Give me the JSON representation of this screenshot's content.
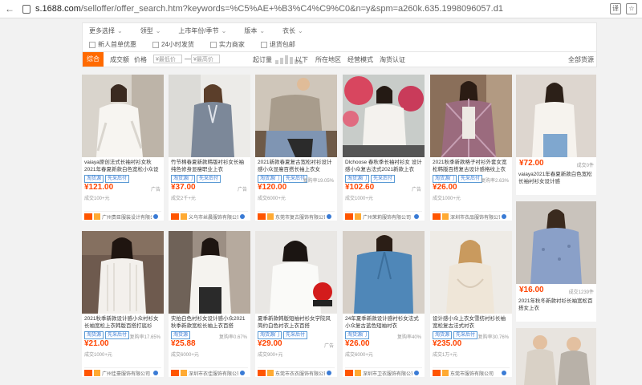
{
  "address_bar": {
    "url_host": "s.1688.com",
    "url_rest": "/selloffer/offer_search.htm?keywords=%C5%AE+%B3%C4%C9%C0&n=y&spm=a260k.635.1998096057.d1"
  },
  "filters": {
    "row1": [
      "更多选择",
      "领型",
      "上市年份/季节",
      "版本",
      "衣长"
    ],
    "row2": [
      "新人首单优惠",
      "24小时发货",
      "实力商家",
      "退货包邮"
    ]
  },
  "sort": {
    "comprehensive": "综合",
    "sales": "成交额",
    "price": "价格",
    "price_min_placeholder": "¥最低价",
    "dash": "—",
    "price_max_placeholder": "¥最高价",
    "start_qty_label": "起订量",
    "below": "以下",
    "location": "所在地区",
    "mode": "经营模式",
    "certify": "淘货认证",
    "all_shops": "全部货源"
  },
  "products": [
    {
      "title": "vaiaya原创法式长袖衬衫女秋2021年春夏新款白色宽松小众设计感衬衣",
      "tags": [
        "淘货源",
        "先采后付"
      ],
      "price": "¥121.00",
      "meta": "广告",
      "deal": "成交100+元",
      "shop": "广州贵臣服装设计有限公司"
    },
    {
      "title": "竹节棉春夏新款韩版衬衫女长袖纯色修身显瘦职业上衣",
      "tags": [
        "淘货源门",
        "先采后付"
      ],
      "price": "¥37.00",
      "meta": "广告",
      "deal": "成交2千+元",
      "shop": "义乌市丝晨服饰有限公司"
    },
    {
      "title": "2021新款春夏复古宽松衬衫设计感小众显瘦百搭长袖上衣女",
      "tags": [
        "淘货源门",
        "先采后付"
      ],
      "price": "¥120.00",
      "meta": "复购率19.05%",
      "deal": "成交6000+元",
      "shop": "东莞市复古服饰有限公司"
    },
    {
      "title": "Dlchoose 春秋季长袖衬衫女 设计感小众复古法式2021新款上衣",
      "tags": [
        "淘货源门",
        "先采后付"
      ],
      "price": "¥102.60",
      "meta": "广告",
      "deal": "成交1000+元",
      "shop": "广州茉莉服饰有限公司"
    },
    {
      "title": "2021秋季新款格子衬衫外套女宽松韩版百搭复古设计感格纹上衣",
      "tags": [
        "淘货源门",
        "先采后付"
      ],
      "price": "¥26.00",
      "meta": "复购率2.63%",
      "deal": "成交1000+元",
      "shop": "深圳市衣品服饰有限公司"
    },
    {
      "title": "2021秋季新款设计感小众衬衫女长袖宽松上衣韩版百搭打底衫",
      "tags": [
        "淘货源",
        "先采后付"
      ],
      "price": "¥21.00",
      "meta": "复购率17.65%",
      "deal": "成交1000+元",
      "shop": "广州佳豪服饰有限公司"
    },
    {
      "title": "实拍白色衬衫女设计感小众2021秋季新款宽松长袖上衣百搭",
      "tags": [
        "淘货源"
      ],
      "price": "¥25.88",
      "meta": "复购率0.67%",
      "deal": "成交6000+元",
      "shop": "深圳市衣佳服饰有限公司"
    },
    {
      "title": "夏季新款韩版短袖衬衫女学院风简约白色衬衣上衣百搭",
      "tags": [
        "淘货源门",
        "先采后付"
      ],
      "price": "¥29.00",
      "meta": "广告",
      "deal": "成交900+元",
      "shop": "东莞市衣衣服饰有限公司"
    },
    {
      "title": "24年夏季新款设计感衬衫女法式小众复古蓝色短袖衬衣",
      "tags": [
        "淘货源门"
      ],
      "price": "¥26.00",
      "meta": "复购率40%",
      "deal": "成交6000+元",
      "shop": "深圳市卫衣服饰有限公司"
    },
    {
      "title": "设计感小众上衣女雪纺衬衫长袖宽松复古法式衬衣",
      "tags": [
        "淘货源",
        "先采后付"
      ],
      "price": "¥235.00",
      "meta": "复购率30.76%",
      "deal": "成交1万+元",
      "shop": "东莞市服饰有限公司"
    }
  ],
  "side_products": [
    {
      "price": "¥72.00",
      "sub": "成交0件",
      "title": "vaiaya2021年春夏新款白色宽松长袖衬衫女设计感"
    },
    {
      "price": "¥16.00",
      "sub": "成交1239件",
      "title": "2021年秋冬新款衬衫长袖宽松百搭女上衣"
    }
  ]
}
